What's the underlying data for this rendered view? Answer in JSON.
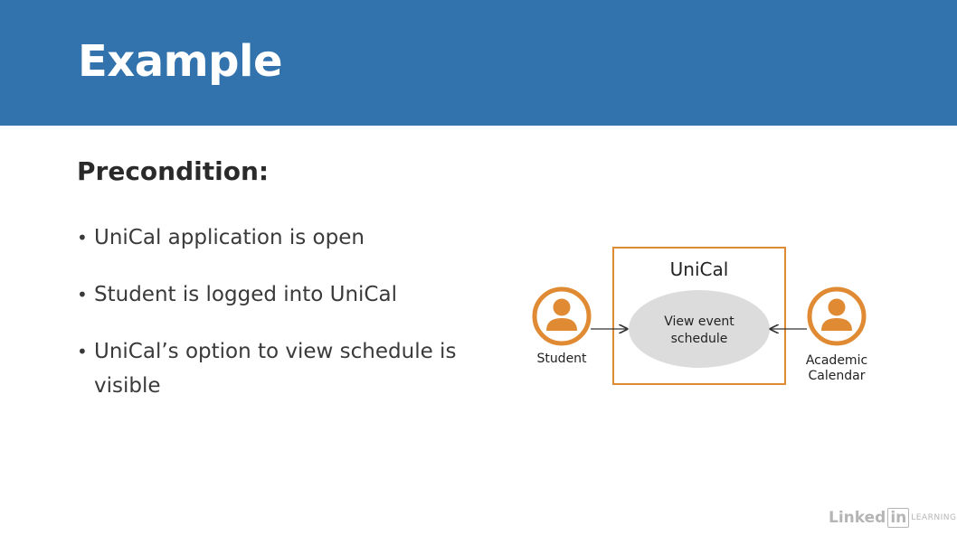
{
  "header": {
    "title": "Example"
  },
  "content": {
    "heading": "Precondition:",
    "bullets": [
      "UniCal application is open",
      "Student is logged into UniCal",
      "UniCal’s option to view schedule is visible"
    ]
  },
  "diagram": {
    "system_name": "UniCal",
    "use_case_line1": "View event",
    "use_case_line2": "schedule",
    "actor_left": "Student",
    "actor_right_line1": "Academic",
    "actor_right_line2": "Calendar",
    "colors": {
      "accent": "#e08a33",
      "use_case_fill": "#dcdcdc"
    }
  },
  "watermark": {
    "brand_a": "Linked",
    "brand_b": "in",
    "brand_c": "LEARNING"
  }
}
